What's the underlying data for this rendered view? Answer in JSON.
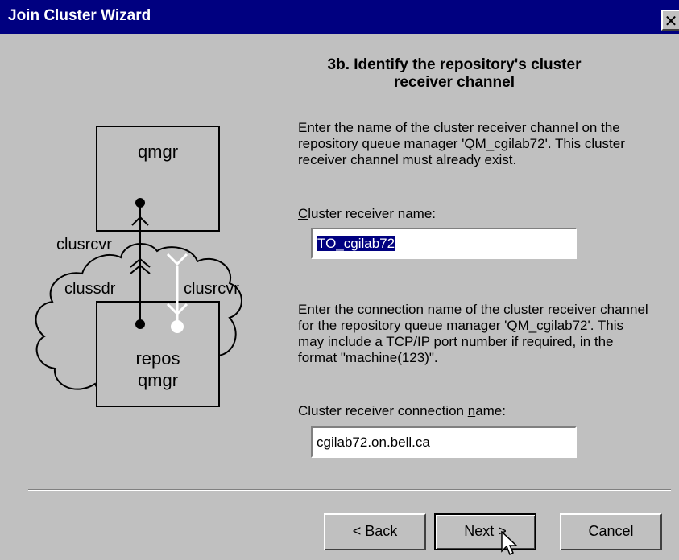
{
  "window": {
    "title": "Join Cluster Wizard",
    "close_glyph": "✕"
  },
  "step": {
    "title": "3b. Identify the repository's cluster receiver channel"
  },
  "instructions": {
    "receiver_name": "Enter the name of the cluster receiver channel on the repository queue manager 'QM_cgilab72'. This cluster receiver channel must already exist.",
    "connection_name": "Enter the connection name of the cluster receiver channel for the repository queue manager 'QM_cgilab72'. This may include a TCP/IP port number if required, in the format \"machine(123)\"."
  },
  "fields": {
    "receiver_name": {
      "label_pre": "",
      "label_mnemonic": "C",
      "label_post": "luster receiver name:",
      "value": "TO_cgilab72"
    },
    "connection_name": {
      "label_pre": "Cluster receiver connection ",
      "label_mnemonic": "n",
      "label_post": "ame:",
      "value": "cgilab72.on.bell.ca"
    }
  },
  "diagram": {
    "qmgr_label": "qmgr",
    "repos_label_1": "repos",
    "repos_label_2": "qmgr",
    "clusrcvr_top": "clusrcvr",
    "clussdr": "clussdr",
    "clusrcvr_right": "clusrcvr"
  },
  "buttons": {
    "back": {
      "pre": "< ",
      "mnemonic": "B",
      "post": "ack"
    },
    "next": {
      "pre": "",
      "mnemonic": "N",
      "post": "ext >"
    },
    "cancel": "Cancel"
  },
  "colors": {
    "title_bar": "#000080",
    "dialog_bg": "#c0c0c0",
    "selection": "#000080"
  }
}
